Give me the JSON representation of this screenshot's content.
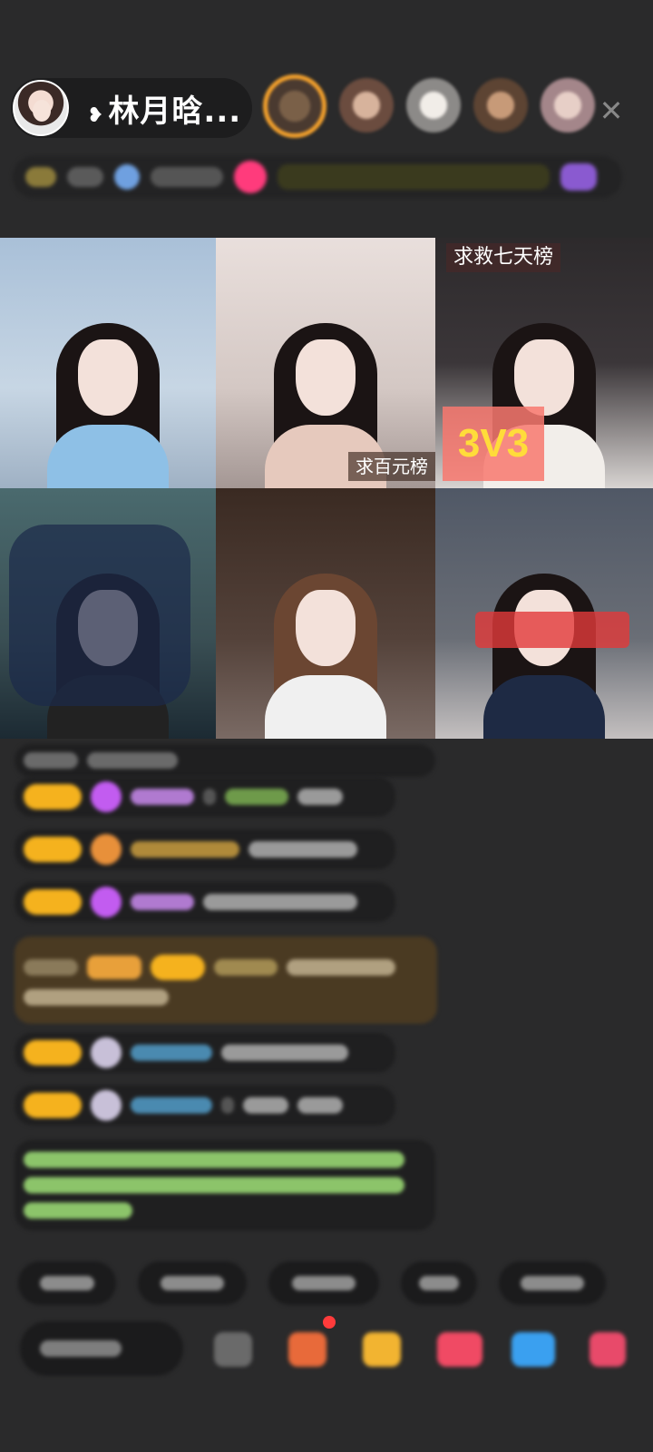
{
  "host": {
    "name": "林月晗...",
    "heart": "❥"
  },
  "close_label": "✕",
  "video_grid": {
    "cell_1_tag": "求救七天榜",
    "cell_1_big": "3V3",
    "cell_2_tag": "求百元榜"
  },
  "colors": {
    "badge_gold": "#f5b21e",
    "gem_purple": "#c25cf0",
    "highlight_bg": "#4a3a22",
    "green_text": "#8cc46a"
  }
}
